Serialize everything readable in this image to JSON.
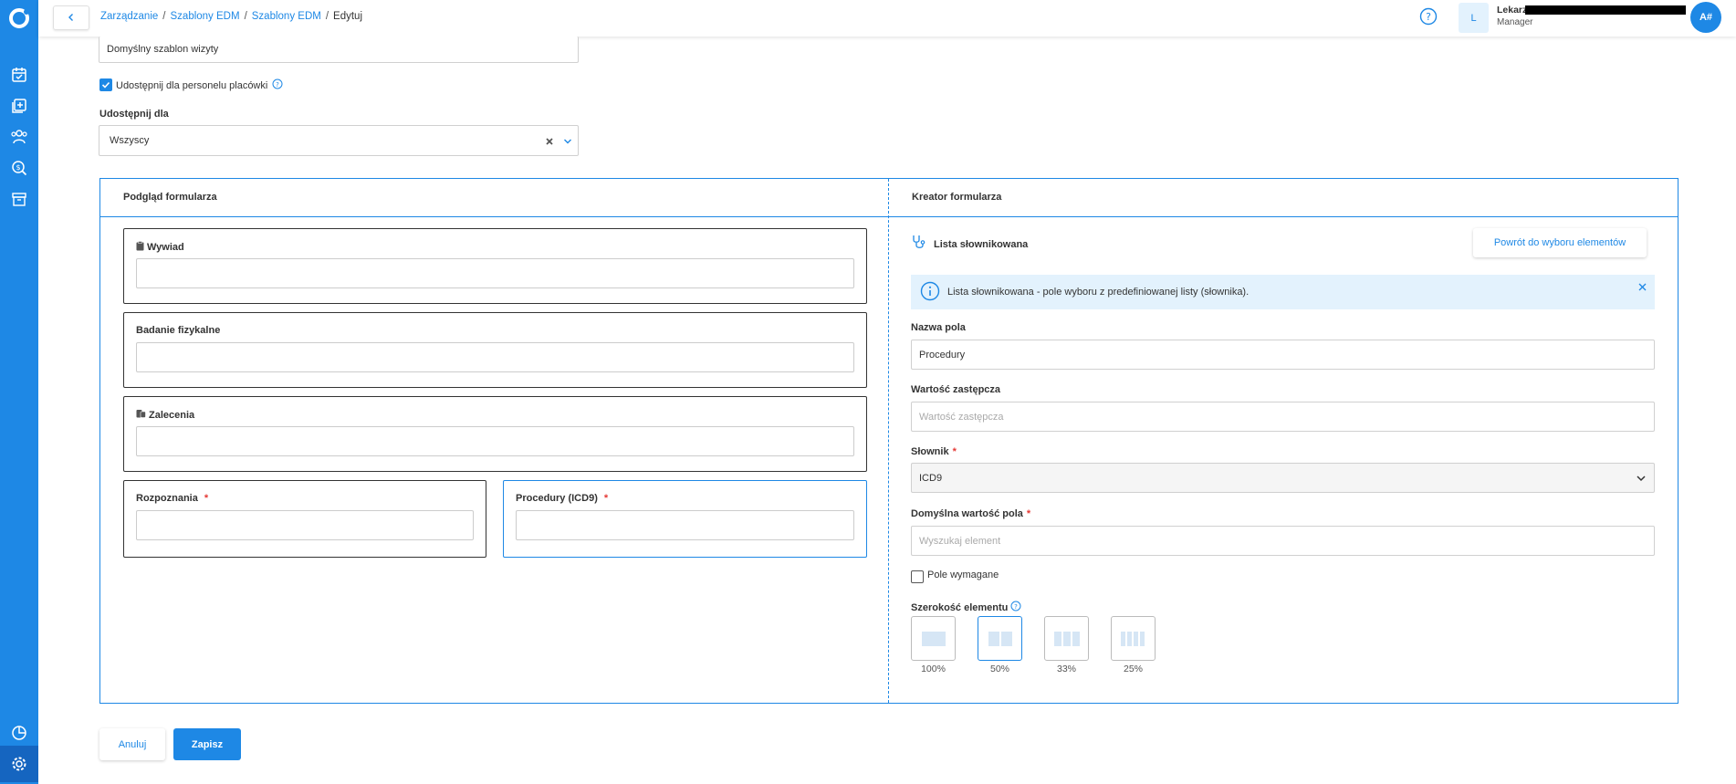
{
  "breadcrumb": {
    "items": [
      "Zarządzanie",
      "Szablony EDM",
      "Szablony EDM"
    ],
    "separator": "/",
    "current": "Edytuj"
  },
  "user": {
    "initial": "L",
    "name": "Lekarz B",
    "role": "Manager",
    "circle": "A#"
  },
  "form": {
    "template_name_value": "Domyślny szablon wizyty",
    "share_staff_label": "Udostępnij dla personelu placówki",
    "share_for_label": "Udostępnij dla",
    "share_for_value": "Wszyscy"
  },
  "preview": {
    "title": "Podgląd formularza",
    "fields": {
      "wywiad": "Wywiad",
      "badanie": "Badanie fizykalne",
      "zalecenia": "Zalecenia",
      "rozpoznania": "Rozpoznania",
      "procedury": "Procedury (ICD9)"
    },
    "required_mark": "*"
  },
  "creator": {
    "title": "Kreator formularza",
    "element_type": "Lista słownikowana",
    "back_button": "Powrót do wyboru elementów",
    "info_text": "Lista słownikowana - pole wyboru z predefiniowanej listy (słownika).",
    "field_name_label": "Nazwa pola",
    "field_name_value": "Procedury",
    "substitute_label": "Wartość zastępcza",
    "substitute_placeholder": "Wartość zastępcza",
    "dictionary_label": "Słownik",
    "dictionary_value": "ICD9",
    "default_label": "Domyślna wartość pola",
    "default_placeholder": "Wyszukaj element",
    "required_checkbox_label": "Pole wymagane",
    "width_label": "Szerokość elementu",
    "width_options": [
      "100%",
      "50%",
      "33%",
      "25%"
    ],
    "width_selected": "50%",
    "required_mark": "*"
  },
  "actions": {
    "cancel": "Anuluj",
    "save": "Zapisz"
  },
  "colors": {
    "accent": "#1e88e5",
    "sidebar": "#1e88e5",
    "info_bg": "#e3f2fd",
    "required": "#e53935"
  }
}
